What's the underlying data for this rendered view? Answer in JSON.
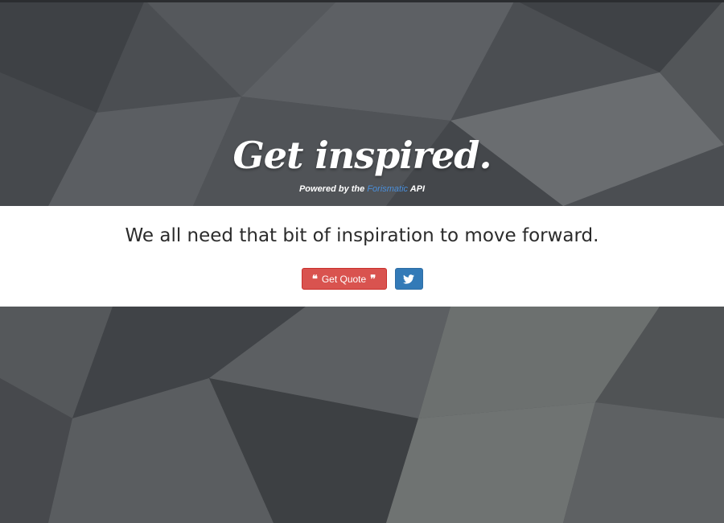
{
  "hero": {
    "title": "Get inspired.",
    "subtitle_prefix": "Powered by the",
    "subtitle_link": "Forismatic",
    "subtitle_suffix": "API"
  },
  "quote": {
    "text": "We all need that bit of inspiration to move forward."
  },
  "actions": {
    "get_quote_label": "Get Quote",
    "get_quote_open_icon": "❝",
    "get_quote_close_icon": "❞",
    "tweet_icon": "twitter-icon"
  },
  "colors": {
    "background": "#4a4d51",
    "link": "#4a8fdb",
    "quote_button": "#d9534f",
    "tweet_button": "#337ab7",
    "band": "#ffffff"
  }
}
